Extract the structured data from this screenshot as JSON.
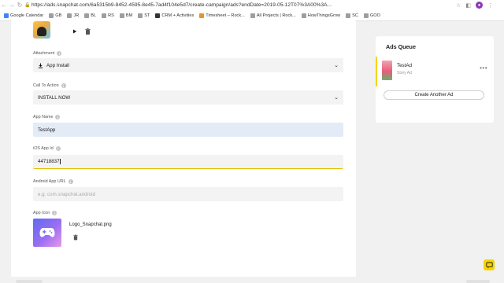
{
  "browser": {
    "url": "https://ads.snapchat.com/6a5315b9-8452-4595-8e45-7ad4f104e5d7/create-campaign/ads?endDate=2019-05-12T07%3A00%3A..."
  },
  "bookmarks": [
    {
      "label": "Google Calendar",
      "color": "#4285f4"
    },
    {
      "label": "GB",
      "color": "#9e9e9e"
    },
    {
      "label": "JR",
      "color": "#9e9e9e"
    },
    {
      "label": "BL",
      "color": "#9e9e9e"
    },
    {
      "label": "RS",
      "color": "#9e9e9e"
    },
    {
      "label": "BM",
      "color": "#9e9e9e"
    },
    {
      "label": "ST",
      "color": "#9e9e9e"
    },
    {
      "label": "CRM + Activities",
      "color": "#333333"
    },
    {
      "label": "Timesheet – Rock...",
      "color": "#e8912d"
    },
    {
      "label": "All Projects | Rock...",
      "color": "#9e9e9e"
    },
    {
      "label": "HowThingsGrow",
      "color": "#9e9e9e"
    },
    {
      "label": "SC",
      "color": "#9e9e9e"
    },
    {
      "label": "GOO",
      "color": "#9e9e9e"
    }
  ],
  "form": {
    "attachment": {
      "label": "Attachment",
      "value": "App Install",
      "icon": "download-icon"
    },
    "call_to_action": {
      "label": "Call To Action",
      "value": "INSTALL NOW"
    },
    "app_name": {
      "label": "App Name",
      "value": "TestApp"
    },
    "ios_app_id": {
      "label": "iOS App Id",
      "value": "44718837"
    },
    "android_app_url": {
      "label": "Android App URL",
      "placeholder": "e.g. com.snapchat.android"
    },
    "app_icon": {
      "label": "App Icon",
      "file_name": "Logo_Snapchat.png"
    }
  },
  "ads_queue": {
    "title": "Ads Queue",
    "items": [
      {
        "name": "TestAd",
        "type": "Story Ad"
      }
    ],
    "create_button": "Create Another Ad"
  },
  "colors": {
    "accent": "#f7d300",
    "input_filled": "#e3ebf7",
    "focus_underline": "#e5c100"
  }
}
